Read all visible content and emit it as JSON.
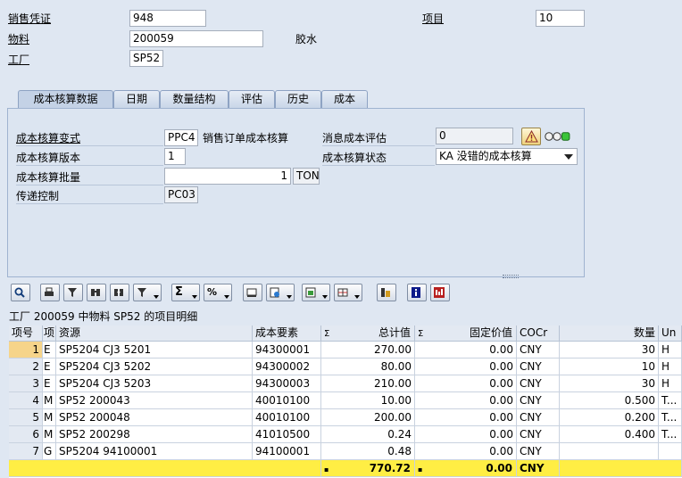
{
  "header": {
    "sales_doc_label": "销售凭证",
    "sales_doc_value": "948",
    "item_label": "项目",
    "item_value": "10",
    "material_label": "物料",
    "material_value": "200059",
    "material_desc": "胶水",
    "plant_label": "工厂",
    "plant_value": "SP52"
  },
  "tabs": [
    {
      "label": "成本核算数据",
      "active": true
    },
    {
      "label": "日期",
      "active": false
    },
    {
      "label": "数量结构",
      "active": false
    },
    {
      "label": "评估",
      "active": false
    },
    {
      "label": "历史",
      "active": false
    },
    {
      "label": "成本",
      "active": false
    }
  ],
  "form": {
    "variant_label": "成本核算变式",
    "variant_value": "PPC4",
    "variant_desc": "销售订单成本核算",
    "version_label": "成本核算版本",
    "version_value": "1",
    "lotsize_label": "成本核算批量",
    "lotsize_value": "1",
    "lotsize_unit": "TON",
    "transfer_label": "传递控制",
    "transfer_value": "PC03",
    "messages_label": "消息成本评估",
    "messages_value": "0",
    "status_label": "成本核算状态",
    "status_value": "KA 没错的成本核算"
  },
  "grid": {
    "title": "工厂 200059 中物料 SP52 的项目明细",
    "columns": {
      "item_no": "项号",
      "cat": "项",
      "resource": "资源",
      "cost_element": "成本要素",
      "total_sigma": "Σ",
      "total_value": "总计值",
      "fixed_sigma": "Σ",
      "fixed_value": "固定价值",
      "cocr": "COCr",
      "quantity": "数量",
      "unit": "Un"
    },
    "rows": [
      {
        "no": "1",
        "cat": "E",
        "res": "SP5204    CJ3      5201",
        "ce": "94300001",
        "total": "270.00",
        "fixed": "0.00",
        "cur": "CNY",
        "qty": "30",
        "unit": "H"
      },
      {
        "no": "2",
        "cat": "E",
        "res": "SP5204    CJ3      5202",
        "ce": "94300002",
        "total": "80.00",
        "fixed": "0.00",
        "cur": "CNY",
        "qty": "10",
        "unit": "H"
      },
      {
        "no": "3",
        "cat": "E",
        "res": "SP5204    CJ3      5203",
        "ce": "94300003",
        "total": "210.00",
        "fixed": "0.00",
        "cur": "CNY",
        "qty": "30",
        "unit": "H"
      },
      {
        "no": "4",
        "cat": "M",
        "res": "SP52 200043",
        "ce": "40010100",
        "total": "10.00",
        "fixed": "0.00",
        "cur": "CNY",
        "qty": "0.500",
        "unit": "T..."
      },
      {
        "no": "5",
        "cat": "M",
        "res": "SP52 200048",
        "ce": "40010100",
        "total": "200.00",
        "fixed": "0.00",
        "cur": "CNY",
        "qty": "0.200",
        "unit": "T..."
      },
      {
        "no": "6",
        "cat": "M",
        "res": "SP52 200298",
        "ce": "41010500",
        "total": "0.24",
        "fixed": "0.00",
        "cur": "CNY",
        "qty": "0.400",
        "unit": "T..."
      },
      {
        "no": "7",
        "cat": "G",
        "res": "SP5204 94100001",
        "ce": "94100001",
        "total": "0.48",
        "fixed": "0.00",
        "cur": "CNY",
        "qty": "",
        "unit": ""
      }
    ],
    "totals": {
      "mark1": "▪",
      "total": "770.72",
      "mark2": "▪",
      "fixed": "0.00",
      "cur": "CNY"
    }
  },
  "icons": {
    "toolbar": [
      "details-icon",
      "print-icon",
      "filter-icon",
      "find-icon",
      "sort-filter-icon",
      "sum-icon",
      "subtotal-icon",
      "print-preview-icon",
      "export-icon",
      "layout-icon",
      "grid-layout-icon",
      "hierarchy-icon",
      "info-icon",
      "abc-analysis-icon"
    ]
  },
  "colors": {
    "background": "#dfe7f2",
    "selected_row": "#f6d48a",
    "total_row": "#ffee44"
  }
}
